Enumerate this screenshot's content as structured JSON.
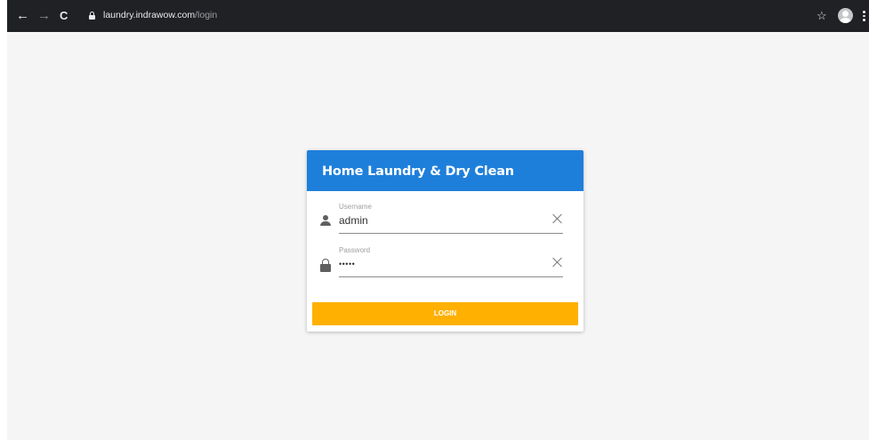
{
  "browser": {
    "nav": {
      "back": "←",
      "forward": "→",
      "reload": "C"
    },
    "url_host": "laundry.indrawow.com",
    "url_path": "/login",
    "star": "☆"
  },
  "login": {
    "title": "Home Laundry & Dry Clean",
    "username": {
      "label": "Username",
      "value": "admin"
    },
    "password": {
      "label": "Password",
      "masked_value": "•••••"
    },
    "button_label": "LOGIN"
  },
  "colors": {
    "header_blue": "#1e7fdb",
    "button_amber": "#ffb000",
    "page_bg": "#f5f5f5"
  }
}
